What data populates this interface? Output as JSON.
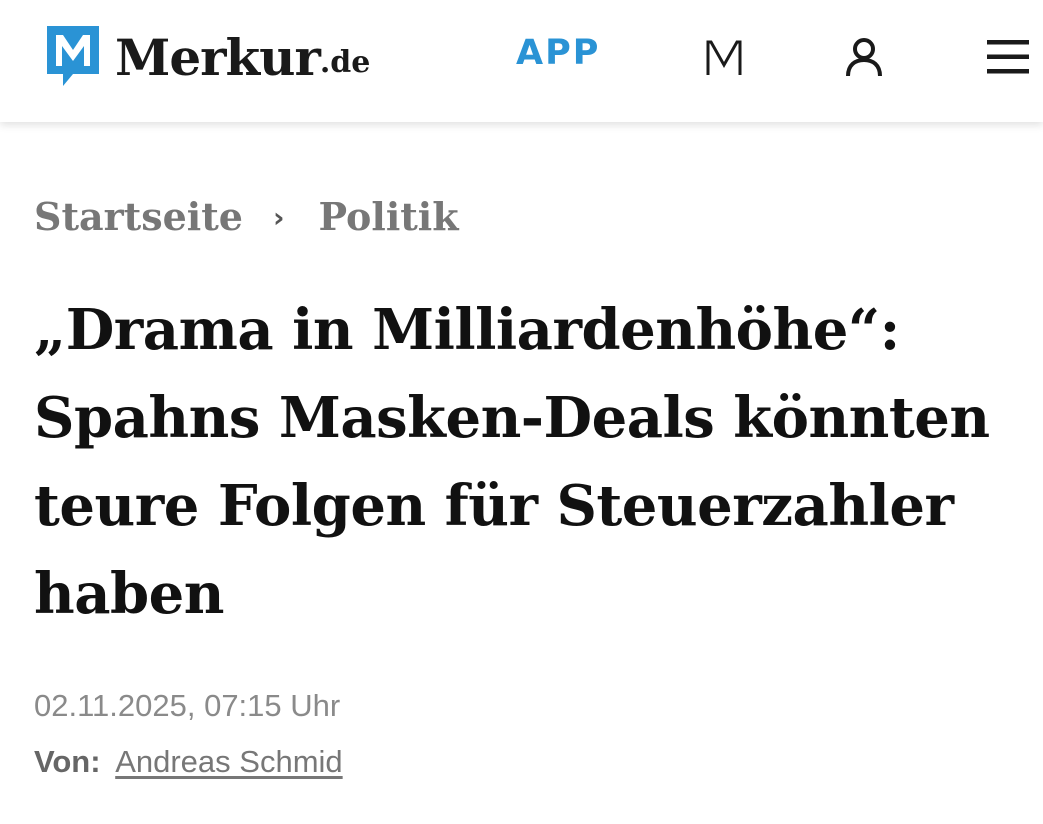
{
  "header": {
    "logo_text": "Merkur",
    "logo_tld": ".de",
    "app_label": "APP",
    "brand_color": "#2a93d5",
    "icons": [
      "merkur-m-icon",
      "user-icon",
      "menu-icon"
    ]
  },
  "breadcrumb": {
    "items": [
      "Startseite",
      "Politik"
    ],
    "separator": "›"
  },
  "article": {
    "headline": "„Drama in Milliardenhöhe“: Spahns Masken-Deals könnten teure Folgen für Steuerzahler haben",
    "dateline": "02.11.2025, 07:15 Uhr",
    "byline_label": "Von:",
    "author": "Andreas Schmid"
  }
}
